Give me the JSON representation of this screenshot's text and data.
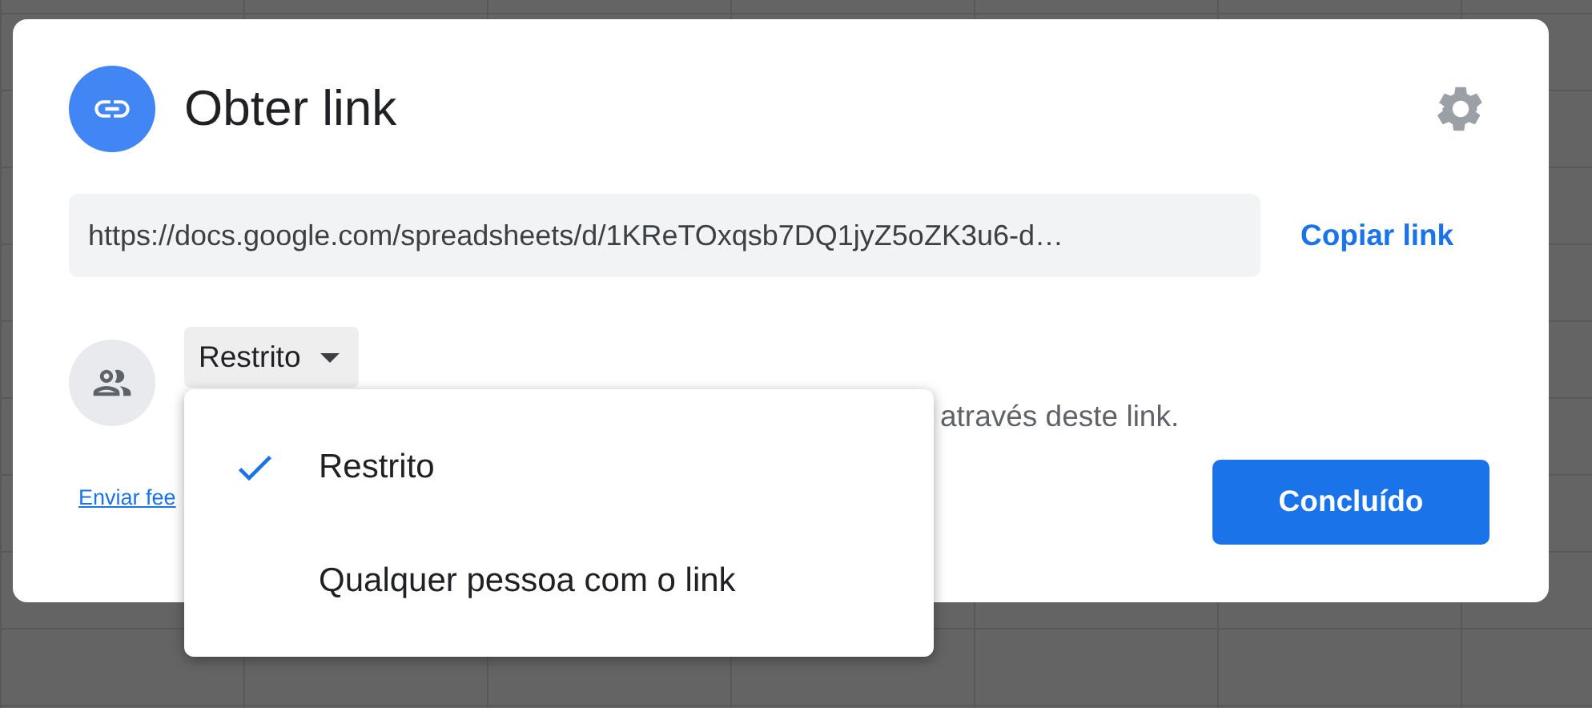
{
  "dialog": {
    "title": "Obter link",
    "link_url": "https://docs.google.com/spreadsheets/d/1KReTOxqsb7DQ1jyZ5oZK3u6-d…",
    "copy_link": "Copiar link",
    "access": {
      "dropdown": "Restrito",
      "hint": "através deste link."
    },
    "feedback_link": "Enviar fee",
    "done_button": "Concluído"
  },
  "menu": {
    "items": [
      {
        "label": "Restrito",
        "selected": true
      },
      {
        "label": "Qualquer pessoa com o link",
        "selected": false
      }
    ]
  }
}
